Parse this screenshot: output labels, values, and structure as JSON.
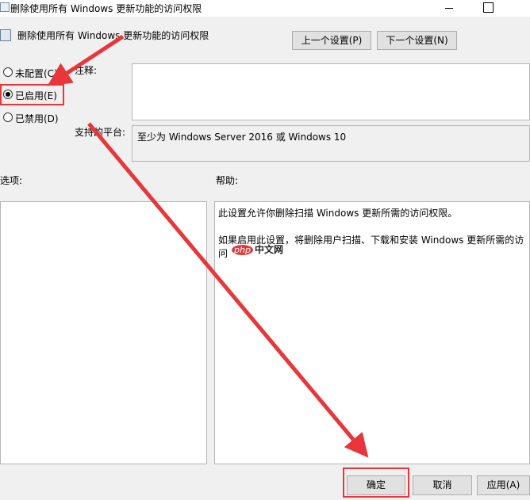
{
  "window": {
    "title": "删除使用所有 Windows 更新功能的访问权限"
  },
  "header": {
    "policy_title": "删除使用所有 Windows 更新功能的访问权限",
    "prev_label": "上一个设置(P)",
    "next_label": "下一个设置(N)"
  },
  "state": {
    "options": [
      {
        "label": "未配置(C)",
        "checked": false
      },
      {
        "label": "已启用(E)",
        "checked": true
      },
      {
        "label": "已禁用(D)",
        "checked": false
      }
    ]
  },
  "labels": {
    "comment": "注释:",
    "supported_on": "支持的平台:",
    "options": "选项:",
    "help": "帮助:"
  },
  "comment": {
    "value": ""
  },
  "supported_on": {
    "value": "至少为 Windows Server 2016 或 Windows 10"
  },
  "help": {
    "para1": "此设置允许你删除扫描 Windows 更新所需的访问权限。",
    "para2": "如果启用此设置，将删除用户扫描、下载和安装 Windows 更新所需的访问"
  },
  "watermark": {
    "logo": "php",
    "text": "中文网"
  },
  "footer": {
    "ok_label": "确定",
    "cancel_label": "取消",
    "apply_label": "应用(A)"
  },
  "colors": {
    "annotation": "#e8363a",
    "background": "#f0f0f0"
  }
}
